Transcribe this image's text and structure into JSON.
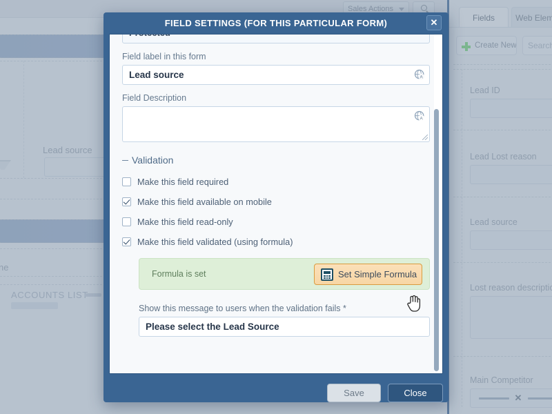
{
  "modal": {
    "title": "FIELD SETTINGS (FOR THIS PARTICULAR FORM)",
    "close_icon": "close-icon",
    "close_glyph": "✕",
    "protected_value": "Protected",
    "field_label_caption": "Field label in this form",
    "field_label_value": "Lead source",
    "field_description_caption": "Field Description",
    "field_description_value": "",
    "i18n_icon": "translate-globe-icon",
    "validation": {
      "legend": "Validation",
      "collapse_marker": "−",
      "checkboxes": [
        {
          "label": "Make this field required",
          "checked": false
        },
        {
          "label": "Make this field available on mobile",
          "checked": true
        },
        {
          "label": "Make this field read-only",
          "checked": false
        },
        {
          "label": "Make this field validated (using formula)",
          "checked": true
        }
      ],
      "formula_status": "Formula is set",
      "formula_button_label": "Set Simple Formula",
      "formula_button_icon": "calculator-icon",
      "message_caption": "Show this message to users when the validation fails *",
      "message_value": "Please select the Lead Source"
    },
    "footer": {
      "save_label": "Save",
      "close_label": "Close"
    }
  },
  "sidebar": {
    "tabs": [
      {
        "label": "Fields",
        "active": true
      },
      {
        "label": "Web Elements",
        "active": false
      }
    ],
    "create_new_label": "Create New",
    "create_new_icon": "plus-icon",
    "search_placeholder": "Search",
    "fields": [
      {
        "label": "Lead ID"
      },
      {
        "label": "Lead Lost reason"
      },
      {
        "label": "Lead source"
      },
      {
        "label": "Lost reason description"
      },
      {
        "label": "Main Competitor"
      }
    ],
    "competitor_clear_glyph": "✕"
  },
  "background": {
    "sales_actions_label": "Sales Actions",
    "search_icon": "search-icon",
    "lead_source_label": "Lead source",
    "accounts_list_label": "ACCOUNTS LIST",
    "name_fragment": "ne"
  },
  "colors": {
    "modal_chrome": "#3a6593",
    "accent_orange": "#d99b3e",
    "formula_green_bg": "#deefd8",
    "sidebar_accent": "#3f6694",
    "plus_green": "#6cc077"
  }
}
